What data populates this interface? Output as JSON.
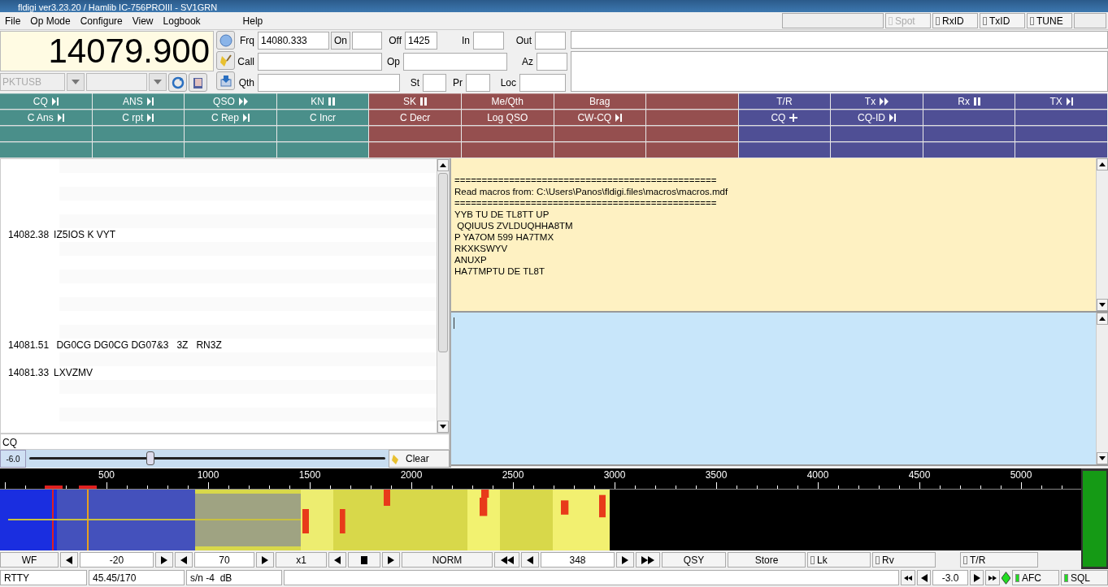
{
  "window": {
    "title": "fldigi ver3.23.20 / Hamlib IC-756PROIII - SV1GRN"
  },
  "menu": [
    {
      "label": "File"
    },
    {
      "label": "Op Mode"
    },
    {
      "label": "Configure"
    },
    {
      "label": "View"
    },
    {
      "label": "Logbook"
    },
    {
      "label": "Help"
    }
  ],
  "menu_toggles": [
    {
      "label": "Spot",
      "checked": false,
      "disabled": true
    },
    {
      "label": "RxID",
      "checked": false,
      "disabled": false
    },
    {
      "label": "TxID",
      "checked": false,
      "disabled": false
    },
    {
      "label": "TUNE",
      "checked": false,
      "disabled": false
    }
  ],
  "frequency_display": "14079.900",
  "mode_select": {
    "value": "PKTUSB",
    "disabled": true
  },
  "log_rows": [
    [
      {
        "kind": "field",
        "label": "Frq",
        "value": "14080.333"
      },
      {
        "kind": "button",
        "label": "On"
      },
      {
        "kind": "field"
      },
      {
        "kind": "field",
        "label": "Off",
        "value": "1425"
      },
      {
        "kind": "field",
        "label": "In"
      },
      {
        "kind": "field",
        "label": "Out"
      }
    ],
    [
      {
        "kind": "field",
        "label": "Call"
      },
      {
        "kind": "field",
        "label": "Op"
      },
      {
        "kind": "field",
        "label": "Az"
      }
    ],
    [
      {
        "kind": "field",
        "label": "Qth"
      },
      {
        "kind": "field",
        "label": "St"
      },
      {
        "kind": "field",
        "label": "Pr"
      },
      {
        "kind": "field",
        "label": "Loc"
      }
    ]
  ],
  "macro_banks": [
    {
      "color": "#4a8f8a",
      "rows": [
        [
          {
            "label": "CQ",
            "kind": "next"
          },
          {
            "label": "ANS",
            "kind": "next"
          },
          {
            "label": "QSO",
            "kind": "ffwd"
          },
          {
            "label": "KN",
            "kind": "pause"
          }
        ],
        [
          {
            "label": "C Ans",
            "kind": "next"
          },
          {
            "label": "C rpt",
            "kind": "next"
          },
          {
            "label": "C Rep",
            "kind": "next"
          },
          {
            "label": "C Incr",
            "kind": "plain"
          }
        ],
        [
          null,
          null,
          null,
          null
        ],
        [
          null,
          null,
          null,
          null
        ]
      ]
    },
    {
      "color": "#954f4f",
      "rows": [
        [
          {
            "label": "SK",
            "kind": "pause"
          },
          {
            "label": "Me/Qth",
            "kind": "plain"
          },
          {
            "label": "Brag",
            "kind": "plain"
          },
          null
        ],
        [
          {
            "label": "C Decr",
            "kind": "plain"
          },
          {
            "label": "Log QSO",
            "kind": "plain"
          },
          {
            "label": "CW-CQ",
            "kind": "next"
          },
          null
        ],
        [
          null,
          null,
          null,
          null
        ],
        [
          null,
          null,
          null,
          null
        ]
      ]
    },
    {
      "color": "#4f4f95",
      "rows": [
        [
          {
            "label": "T/R",
            "kind": "plain"
          },
          {
            "label": "Tx",
            "kind": "ffwd"
          },
          {
            "label": "Rx",
            "kind": "pause"
          },
          {
            "label": "TX",
            "kind": "next"
          }
        ],
        [
          {
            "label": "CQ",
            "kind": "plus"
          },
          {
            "label": "CQ-ID",
            "kind": "next"
          },
          null,
          null
        ],
        [
          null,
          null,
          null,
          null
        ],
        [
          null,
          null,
          null,
          null
        ]
      ]
    }
  ],
  "rx_list": [
    {
      "freq": "14082.38",
      "text": "IZ5IOS K VYT"
    },
    {
      "freq": "14081.51",
      "text": " DG0CG DG0CG DG07&3   3Z   RN3Z"
    },
    {
      "freq": "14081.33",
      "text": "LXVZMV"
    }
  ],
  "cq_field": {
    "value": "CQ"
  },
  "gain_slider": {
    "reading": "-6.0",
    "level": 0.34
  },
  "clear_button": "Clear",
  "rx_text": [
    "================================================",
    "Read macros from: C:\\Users\\Panos\\fldigi.files\\macros\\macros.mdf",
    "================================================",
    "YYB TU DE TL8TT UP",
    " QQIUUS ZVLDUQHHA8TM",
    "P YA7OM 599 HA7TMX",
    "RKXKSWYV",
    "ANUXP",
    "HA7TMPTU DE TL8T"
  ],
  "scale_labels": [
    "500",
    "1000",
    "1500",
    "2000",
    "2500",
    "3000",
    "3500",
    "4000",
    "4500",
    "5000"
  ],
  "controls": [
    {
      "kind": "button",
      "label": "WF"
    },
    {
      "kind": "left"
    },
    {
      "kind": "value",
      "label": "-20"
    },
    {
      "kind": "right"
    },
    {
      "kind": "left"
    },
    {
      "kind": "value",
      "label": "70"
    },
    {
      "kind": "right"
    },
    {
      "kind": "button",
      "label": "x1"
    },
    {
      "kind": "left"
    },
    {
      "kind": "stop"
    },
    {
      "kind": "right"
    },
    {
      "kind": "button",
      "label": "NORM"
    },
    {
      "kind": "fastleft"
    },
    {
      "kind": "left"
    },
    {
      "kind": "value",
      "label": "348"
    },
    {
      "kind": "right"
    },
    {
      "kind": "fastright"
    },
    {
      "kind": "button",
      "label": "QSY"
    },
    {
      "kind": "button",
      "label": "Store"
    },
    {
      "kind": "check",
      "label": "Lk",
      "checked": false
    },
    {
      "kind": "check",
      "label": "Rv",
      "checked": false
    },
    {
      "kind": "check",
      "label": "T/R",
      "checked": false
    }
  ],
  "status": {
    "mode": "RTTY",
    "baud": "45.45/170",
    "snr": "s/n -4  dB",
    "squelch": "-3.0",
    "afc": {
      "label": "AFC",
      "checked": true
    },
    "sql": {
      "label": "SQL",
      "checked": true
    }
  }
}
